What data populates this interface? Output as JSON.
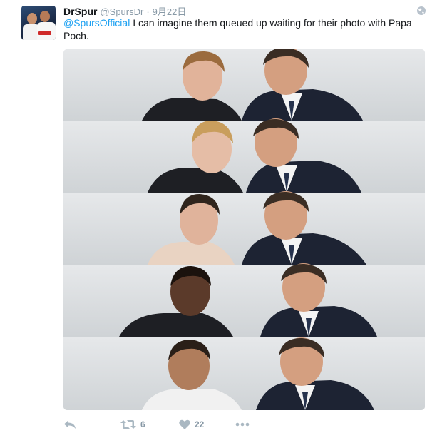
{
  "tweet": {
    "user": {
      "display_name": "DrSpur",
      "handle": "@SpursDr",
      "separator": "·",
      "time": "9月22日"
    },
    "text": {
      "mention": "@SpursOfficial",
      "body": " I can imagine them queued up waiting for their photo with Papa Poch."
    },
    "media": {
      "strips": 5
    },
    "actions": {
      "reply_icon": "reply-icon",
      "retweet_icon": "retweet-icon",
      "retweet_count": "6",
      "like_icon": "heart-icon",
      "like_count": "22",
      "more_icon": "more-icon"
    }
  },
  "colors": {
    "link": "#1da1f2",
    "muted": "#8899a6",
    "text": "#14171a"
  }
}
